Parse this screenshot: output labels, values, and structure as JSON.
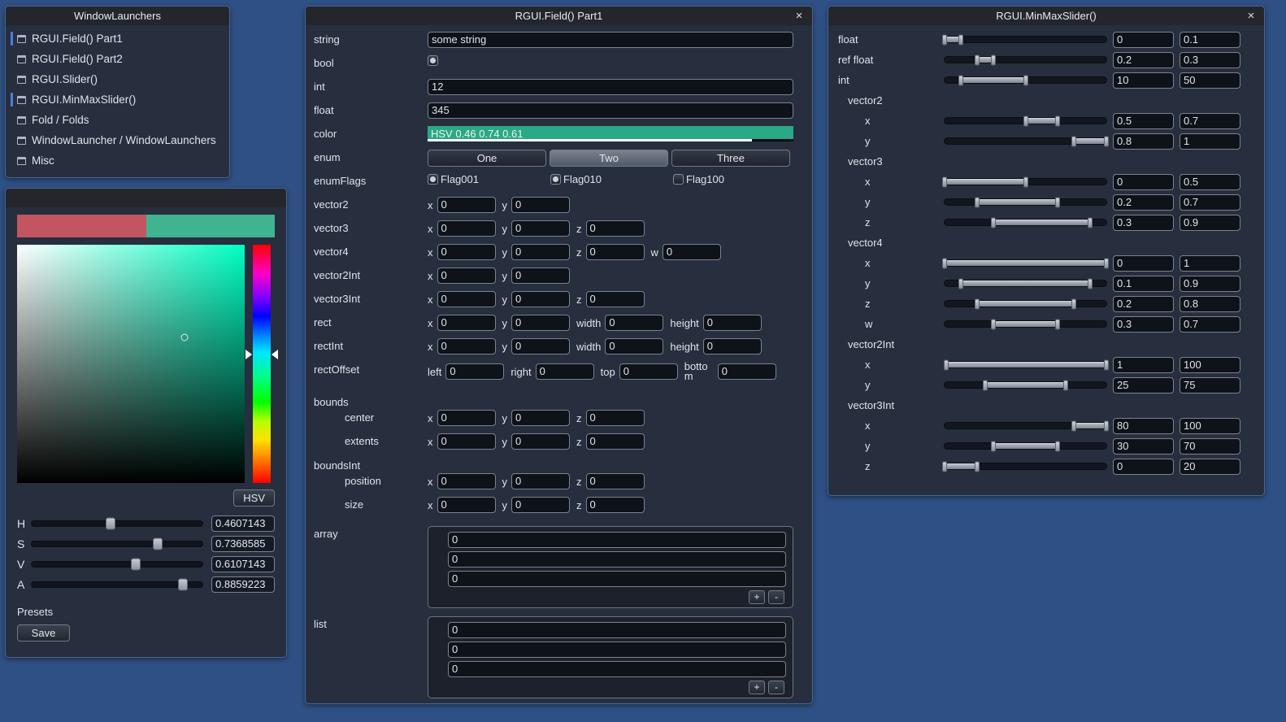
{
  "launchers": {
    "title": "WindowLaunchers",
    "items": [
      {
        "label": "RGUI.Field() Part1",
        "open": true
      },
      {
        "label": "RGUI.Field() Part2",
        "open": false
      },
      {
        "label": "RGUI.Slider()",
        "open": false
      },
      {
        "label": "RGUI.MinMaxSlider()",
        "open": true
      },
      {
        "label": "Fold / Folds",
        "open": false
      },
      {
        "label": "WindowLauncher / WindowLaunchers",
        "open": false
      },
      {
        "label": "Misc",
        "open": false
      }
    ]
  },
  "colorpicker": {
    "swatch_old": "#c25560",
    "swatch_new": "#40b391",
    "mode_button": "HSV",
    "presets_label": "Presets",
    "save_label": "Save",
    "channels": [
      {
        "name": "H",
        "value": "0.4607143",
        "pct": 46.07
      },
      {
        "name": "S",
        "value": "0.7368585",
        "pct": 73.69
      },
      {
        "name": "V",
        "value": "0.6107143",
        "pct": 61.07
      },
      {
        "name": "A",
        "value": "0.8859223",
        "pct": 88.59
      }
    ]
  },
  "fieldwin": {
    "title": "RGUI.Field() Part1",
    "close": "×",
    "labels": {
      "string": "string",
      "bool": "bool",
      "int": "int",
      "float": "float",
      "color": "color",
      "enum": "enum",
      "enumFlags": "enumFlags",
      "vector2": "vector2",
      "vector3": "vector3",
      "vector4": "vector4",
      "vector2Int": "vector2Int",
      "vector3Int": "vector3Int",
      "rect": "rect",
      "rectInt": "rectInt",
      "rectOffset": "rectOffset",
      "bounds": "bounds",
      "center": "center",
      "extents": "extents",
      "boundsInt": "boundsInt",
      "position": "position",
      "size": "size",
      "array": "array",
      "list": "list"
    },
    "axis": {
      "x": "x",
      "y": "y",
      "z": "z",
      "w": "w",
      "width": "width",
      "height": "height",
      "left": "left",
      "right": "right",
      "top": "top",
      "bottom": "botto m"
    },
    "values": {
      "string": "some string",
      "bool": true,
      "int": "12",
      "float": "345",
      "color_text": "HSV 0.46 0.74 0.61",
      "color_hex": "#2ba886",
      "color_alpha_pct": 88.59,
      "zero": "0"
    },
    "enum": {
      "options": [
        "One",
        "Two",
        "Three"
      ],
      "selected": "Two"
    },
    "enumFlags": [
      {
        "label": "Flag001",
        "checked": true
      },
      {
        "label": "Flag010",
        "checked": true
      },
      {
        "label": "Flag100",
        "checked": false
      }
    ],
    "array_items": [
      "0",
      "0",
      "0"
    ],
    "list_items": [
      "0",
      "0",
      "0"
    ],
    "array_buttons": {
      "add": "+",
      "remove": "-"
    }
  },
  "minmaxwin": {
    "title": "RGUI.MinMaxSlider()",
    "close": "×",
    "rows": [
      {
        "label": "float",
        "kind": "row",
        "min": "0",
        "max": "0.1",
        "lo": 0,
        "hi": 10
      },
      {
        "label": "ref float",
        "kind": "row",
        "min": "0.2",
        "max": "0.3",
        "lo": 20,
        "hi": 30
      },
      {
        "label": "int",
        "kind": "row",
        "min": "10",
        "max": "50",
        "lo": 10,
        "hi": 50
      },
      {
        "label": "vector2",
        "kind": "header"
      },
      {
        "label": "x",
        "kind": "sub",
        "min": "0.5",
        "max": "0.7",
        "lo": 50,
        "hi": 70
      },
      {
        "label": "y",
        "kind": "sub",
        "min": "0.8",
        "max": "1",
        "lo": 80,
        "hi": 100
      },
      {
        "label": "vector3",
        "kind": "header"
      },
      {
        "label": "x",
        "kind": "sub",
        "min": "0",
        "max": "0.5",
        "lo": 0,
        "hi": 50
      },
      {
        "label": "y",
        "kind": "sub",
        "min": "0.2",
        "max": "0.7",
        "lo": 20,
        "hi": 70
      },
      {
        "label": "z",
        "kind": "sub",
        "min": "0.3",
        "max": "0.9",
        "lo": 30,
        "hi": 90
      },
      {
        "label": "vector4",
        "kind": "header"
      },
      {
        "label": "x",
        "kind": "sub",
        "min": "0",
        "max": "1",
        "lo": 0,
        "hi": 100
      },
      {
        "label": "y",
        "kind": "sub",
        "min": "0.1",
        "max": "0.9",
        "lo": 10,
        "hi": 90
      },
      {
        "label": "z",
        "kind": "sub",
        "min": "0.2",
        "max": "0.8",
        "lo": 20,
        "hi": 80
      },
      {
        "label": "w",
        "kind": "sub",
        "min": "0.3",
        "max": "0.7",
        "lo": 30,
        "hi": 70
      },
      {
        "label": "vector2Int",
        "kind": "header"
      },
      {
        "label": "x",
        "kind": "sub",
        "min": "1",
        "max": "100",
        "lo": 1,
        "hi": 100
      },
      {
        "label": "y",
        "kind": "sub",
        "min": "25",
        "max": "75",
        "lo": 25,
        "hi": 75
      },
      {
        "label": "vector3Int",
        "kind": "header"
      },
      {
        "label": "x",
        "kind": "sub",
        "min": "80",
        "max": "100",
        "lo": 80,
        "hi": 100
      },
      {
        "label": "y",
        "kind": "sub",
        "min": "30",
        "max": "70",
        "lo": 30,
        "hi": 70
      },
      {
        "label": "z",
        "kind": "sub",
        "min": "0",
        "max": "20",
        "lo": 0,
        "hi": 20
      }
    ]
  }
}
